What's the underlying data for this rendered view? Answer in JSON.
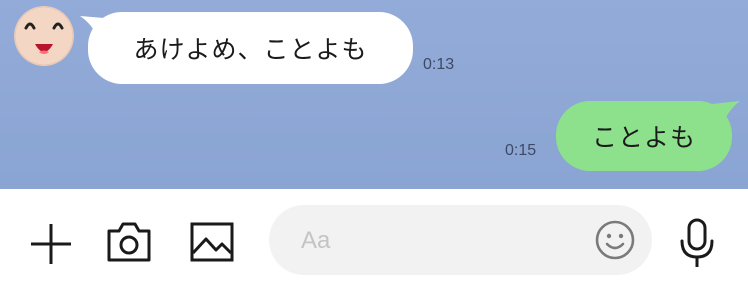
{
  "chat": {
    "messages": [
      {
        "direction": "incoming",
        "text": "あけよめ、ことよも",
        "time": "0:13"
      },
      {
        "direction": "outgoing",
        "text": "ことよも",
        "time": "0:15"
      }
    ]
  },
  "input_bar": {
    "placeholder": "Aa",
    "icons": [
      "plus-icon",
      "camera-icon",
      "image-icon",
      "emoji-icon",
      "microphone-icon"
    ]
  },
  "colors": {
    "chat_background": "#8fa9d6",
    "incoming_bubble": "#ffffff",
    "outgoing_bubble": "#8de18c",
    "input_field": "#f2f2f2"
  }
}
